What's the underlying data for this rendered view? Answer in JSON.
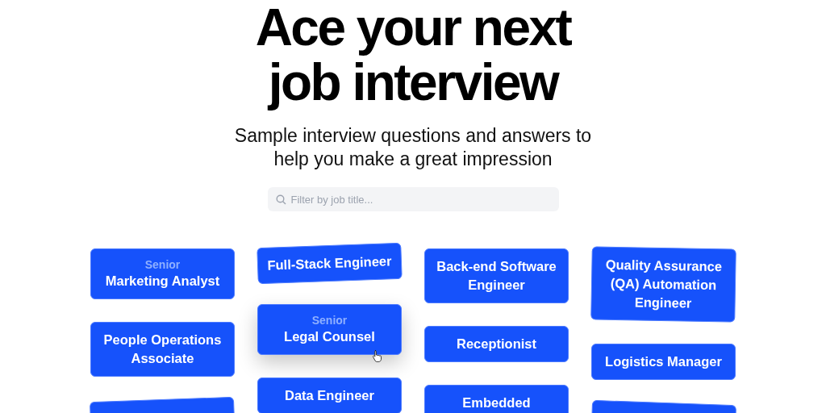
{
  "heading": "Ace your next job interview",
  "subheading": "Sample interview questions and answers to help you make a great impression",
  "search": {
    "placeholder": "Filter by job title..."
  },
  "columns": [
    {
      "cards": [
        {
          "level_label": "Senior",
          "title": "Marketing Analyst",
          "hovered": false
        },
        {
          "title": "People Operations Associate",
          "hovered": false
        },
        {
          "hovered": false
        }
      ]
    },
    {
      "cards": [
        {
          "title": "Full-Stack Engineer",
          "hovered": false
        },
        {
          "level_label": "Senior",
          "title": "Legal Counsel",
          "hovered": true
        },
        {
          "title": "Data Engineer",
          "hovered": false
        }
      ]
    },
    {
      "cards": [
        {
          "title": "Back-end Software Engineer",
          "hovered": false
        },
        {
          "title": "Receptionist",
          "hovered": false
        },
        {
          "title": "Embedded",
          "hovered": false
        }
      ]
    },
    {
      "cards": [
        {
          "title": "Quality Assurance (QA) Automation Engineer",
          "hovered": false
        },
        {
          "title": "Logistics Manager",
          "hovered": false
        },
        {
          "hovered": false
        }
      ]
    }
  ]
}
